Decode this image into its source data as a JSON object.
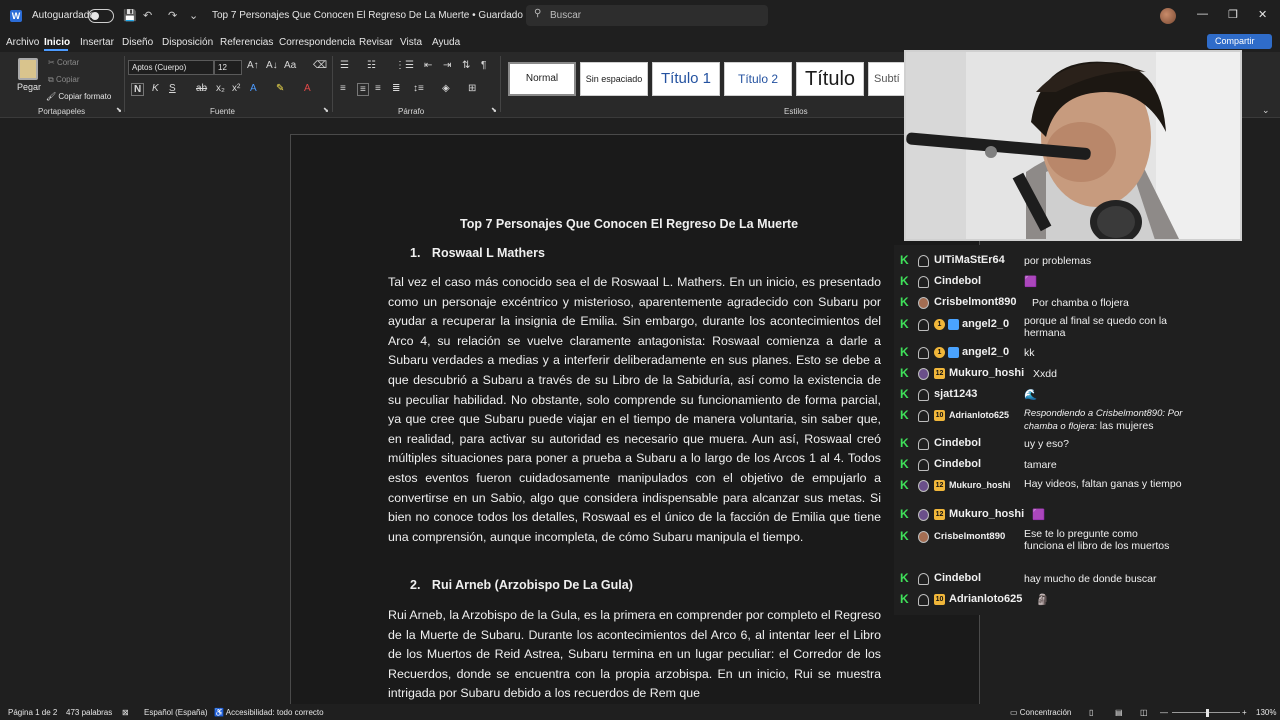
{
  "titlebar": {
    "autosave_label": "Autoguardado",
    "doc_title": "Top 7 Personajes Que Conocen El Regreso De La Muerte • Guardado ⌄",
    "search_placeholder": "Buscar",
    "minimize": "—",
    "restore": "❐",
    "close": "✕"
  },
  "menu": {
    "items": [
      "Archivo",
      "Inicio",
      "Insertar",
      "Diseño",
      "Disposición",
      "Referencias",
      "Correspondencia",
      "Revisar",
      "Vista",
      "Ayuda"
    ],
    "share_label": "Compartir"
  },
  "ribbon": {
    "paste_label": "Pegar",
    "cut_label": "Cortar",
    "copy_label": "Copiar",
    "format_painter_label": "Copiar formato",
    "font_name": "Aptos (Cuerpo)",
    "font_size": "12",
    "groups": {
      "clipboard": "Portapapeles",
      "font": "Fuente",
      "paragraph": "Párrafo",
      "styles": "Estilos"
    },
    "styles": [
      "Normal",
      "Sin espaciado",
      "Título 1",
      "Título 2",
      "Título",
      "Subtí"
    ]
  },
  "document": {
    "title": "Top 7 Personajes Que Conocen El Regreso De La Muerte",
    "h1_num": "1.",
    "h1_text": "Roswaal L Mathers",
    "p1": "Tal vez el caso más conocido sea el de Roswaal L. Mathers. En un inicio, es presentado como un personaje excéntrico y misterioso, aparentemente agradecido con Subaru por ayudar a recuperar la insignia de Emilia. Sin embargo, durante los acontecimientos del Arco 4, su relación se vuelve claramente antagonista: Roswaal comienza a darle a Subaru verdades a medias y a interferir deliberadamente en sus planes. Esto se debe a que descubrió a Subaru a través de su Libro de la Sabiduría, así como la existencia de su peculiar habilidad. No obstante, solo comprende su funcionamiento de forma parcial, ya que cree que Subaru puede viajar en el tiempo de manera voluntaria, sin saber que, en realidad, para activar su autoridad es necesario que muera. Aun así, Roswaal creó múltiples situaciones para poner a prueba a Subaru a lo largo de los Arcos 1 al 4. Todos estos eventos fueron cuidadosamente manipulados con el objetivo de empujarlo a convertirse en un Sabio, algo que considera indispensable para alcanzar sus metas. Si bien no conoce todos los detalles, Roswaal es el único de la facción de Emilia que tiene una comprensión, aunque incompleta, de cómo Subaru manipula el tiempo.",
    "h2_num": "2.",
    "h2_text": "Rui Arneb (Arzobispo De La Gula)",
    "p2": "Rui Arneb, la Arzobispo de la Gula, es la primera en comprender por completo el Regreso de la Muerte de Subaru. Durante los acontecimientos del Arco 6, al intentar leer el Libro de los Muertos de Reid Astrea, Subaru termina en un lugar peculiar: el Corredor de los Recuerdos, donde se encuentra con la propia arzobispa. En un inicio, Rui se muestra intrigada por Subaru debido a los recuerdos de Rem que"
  },
  "chat": [
    {
      "user": "UlTiMaStEr64",
      "msg": "por problemas",
      "badges": []
    },
    {
      "user": "Cindebol",
      "msg": "🟪",
      "badges": []
    },
    {
      "user": "Crisbelmont890",
      "msg": "Por chamba o flojera",
      "badges": [
        "avatar"
      ]
    },
    {
      "user": "angel2_0",
      "msg": "porque al final se quedo con la hermana",
      "badges": [
        "1",
        "prime"
      ]
    },
    {
      "user": "angel2_0",
      "msg": "kk",
      "badges": [
        "1",
        "prime"
      ]
    },
    {
      "user": "Mukuro_hoshi",
      "msg": "Xxdd",
      "badges": [
        "avatar",
        "12"
      ]
    },
    {
      "user": "sjat1243",
      "msg": "🌊",
      "badges": []
    },
    {
      "user": "Adrianloto625",
      "msg": "las mujeres",
      "reply": "Respondiendo a Crisbelmont890: Por chamba o flojera:",
      "badges": [
        "10"
      ]
    },
    {
      "user": "Cindebol",
      "msg": "uy y eso?",
      "badges": []
    },
    {
      "user": "Cindebol",
      "msg": "tamare",
      "badges": []
    },
    {
      "user": "Mukuro_hoshi",
      "msg": "Hay videos, faltan ganas y tiempo",
      "badges": [
        "avatar",
        "12"
      ]
    },
    {
      "user": "Mukuro_hoshi",
      "msg": "🟪",
      "badges": [
        "avatar",
        "12"
      ]
    },
    {
      "user": "Crisbelmont890",
      "msg": "Ese te lo pregunte como funciona el libro de los muertos",
      "badges": [
        "avatar"
      ]
    },
    {
      "user": "Cindebol",
      "msg": "hay mucho de donde buscar",
      "badges": []
    },
    {
      "user": "Adrianloto625",
      "msg": "🗿",
      "badges": [
        "10"
      ]
    }
  ],
  "statusbar": {
    "page": "Página 1 de 2",
    "words": "473 palabras",
    "language": "Español (España)",
    "accessibility": "Accesibilidad: todo correcto",
    "focus": "Concentración",
    "zoom": "130%"
  }
}
